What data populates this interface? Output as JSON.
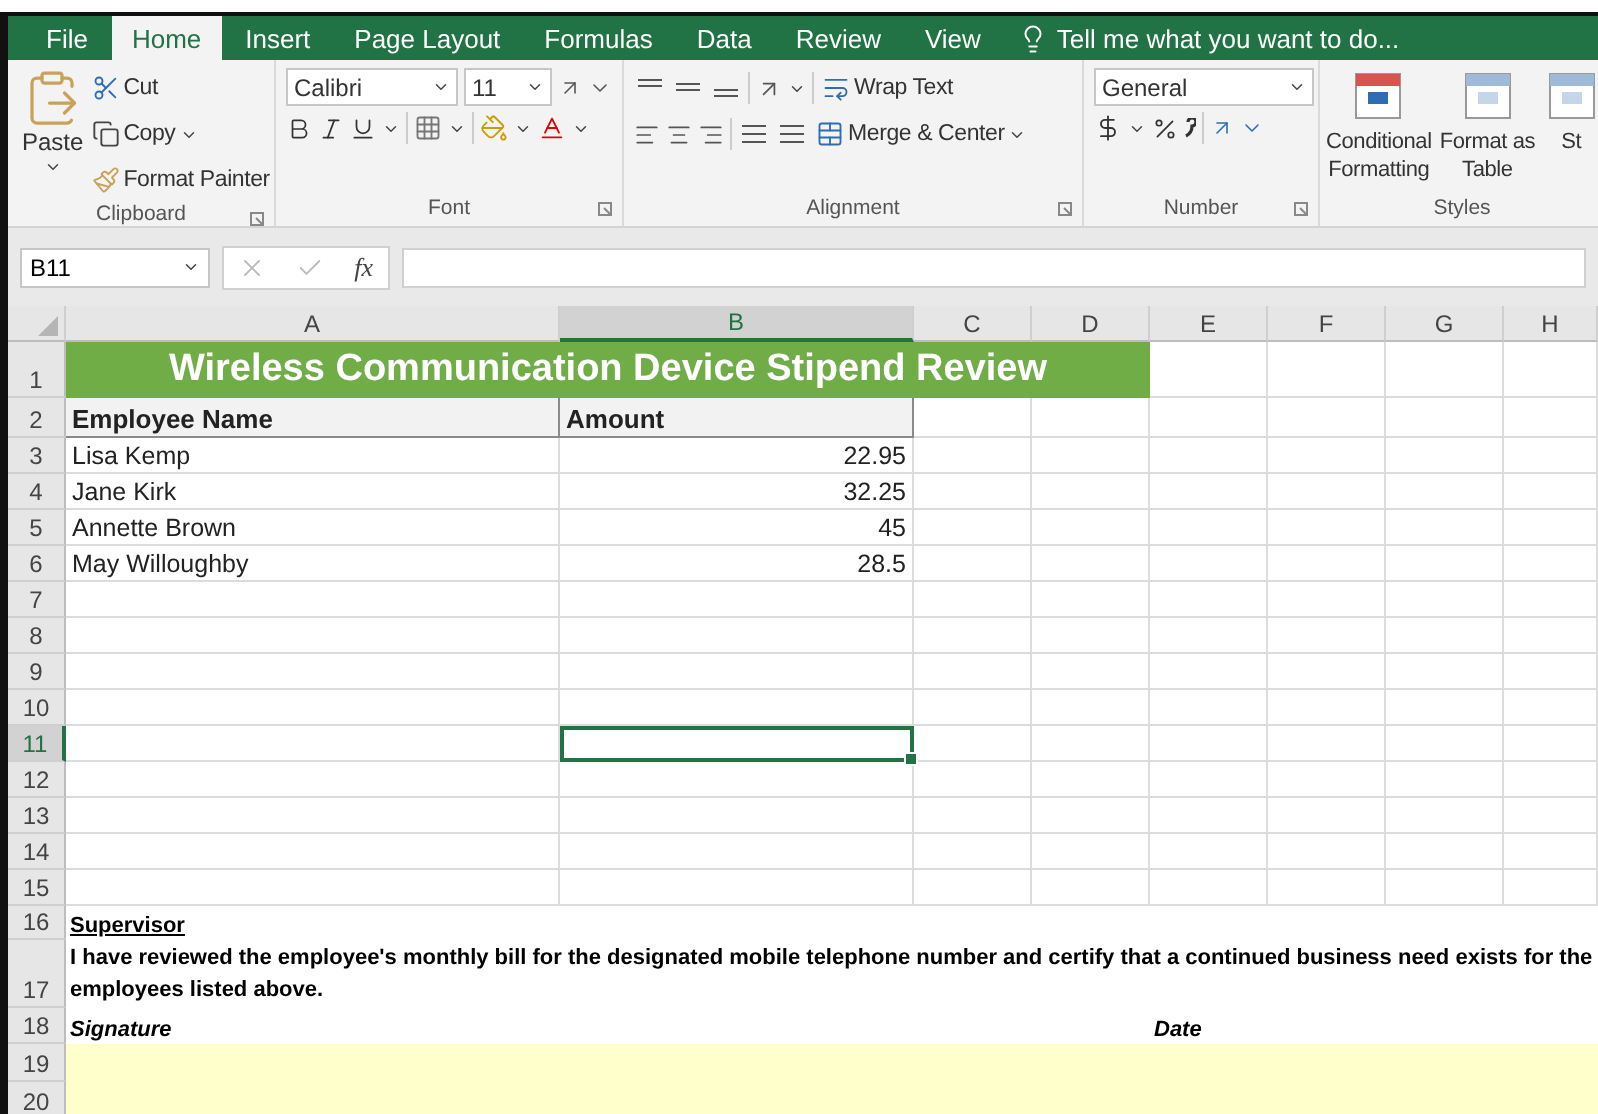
{
  "tabs": [
    {
      "label": "File",
      "selected": false
    },
    {
      "label": "Home",
      "selected": true
    },
    {
      "label": "Insert",
      "selected": false
    },
    {
      "label": "Page Layout",
      "selected": false
    },
    {
      "label": "Formulas",
      "selected": false
    },
    {
      "label": "Data",
      "selected": false
    },
    {
      "label": "Review",
      "selected": false
    },
    {
      "label": "View",
      "selected": false
    }
  ],
  "tell_me": {
    "placeholder": "Tell me what you want to do..."
  },
  "ribbon": {
    "clipboard": {
      "paste": "Paste",
      "cut": "Cut",
      "copy": "Copy",
      "format_painter": "Format Painter",
      "label": "Clipboard"
    },
    "font": {
      "font_name": "Calibri",
      "font_size": "11",
      "label": "Font"
    },
    "alignment": {
      "wrap_text": "Wrap Text",
      "merge_center": "Merge & Center",
      "label": "Alignment"
    },
    "number": {
      "format": "General",
      "label": "Number"
    },
    "styles": {
      "buttons": [
        [
          "Conditional",
          "Formatting"
        ],
        [
          "Format as",
          "Table"
        ],
        [
          "St"
        ]
      ],
      "label": "Styles"
    }
  },
  "formula_bar": {
    "name_box": "B11",
    "fx": "fx"
  },
  "sheet": {
    "columns": [
      {
        "label": "A",
        "selected": false
      },
      {
        "label": "B",
        "selected": true
      },
      {
        "label": "C",
        "selected": false
      },
      {
        "label": "D",
        "selected": false
      },
      {
        "label": "E",
        "selected": false
      },
      {
        "label": "F",
        "selected": false
      },
      {
        "label": "G",
        "selected": false
      },
      {
        "label": "H",
        "selected": false
      }
    ],
    "rows": [
      {
        "number": "1",
        "selected": false,
        "kind": "title",
        "text": "Wireless Communication Device Stipend Review"
      },
      {
        "number": "2",
        "selected": false,
        "kind": "header",
        "cells": [
          "Employee Name",
          "Amount"
        ]
      },
      {
        "number": "3",
        "selected": false,
        "kind": "data",
        "cells": [
          "Lisa Kemp",
          "22.95"
        ]
      },
      {
        "number": "4",
        "selected": false,
        "kind": "data",
        "cells": [
          "Jane Kirk",
          "32.25"
        ]
      },
      {
        "number": "5",
        "selected": false,
        "kind": "data",
        "cells": [
          "Annette Brown",
          "45"
        ]
      },
      {
        "number": "6",
        "selected": false,
        "kind": "data",
        "cells": [
          "May Willoughby",
          "28.5"
        ]
      },
      {
        "number": "7",
        "selected": false,
        "kind": "empty"
      },
      {
        "number": "8",
        "selected": false,
        "kind": "empty"
      },
      {
        "number": "9",
        "selected": false,
        "kind": "empty"
      },
      {
        "number": "10",
        "selected": false,
        "kind": "empty"
      },
      {
        "number": "11",
        "selected": true,
        "kind": "empty"
      },
      {
        "number": "12",
        "selected": false,
        "kind": "empty"
      },
      {
        "number": "13",
        "selected": false,
        "kind": "empty"
      },
      {
        "number": "14",
        "selected": false,
        "kind": "empty"
      },
      {
        "number": "15",
        "selected": false,
        "kind": "empty"
      },
      {
        "number": "16",
        "selected": false,
        "kind": "label",
        "text": "Supervisor"
      },
      {
        "number": "17",
        "selected": false,
        "kind": "note",
        "text": "I have reviewed the employee's monthly bill for the designated mobile telephone number and certify that a continued business need exists for the employees listed above."
      },
      {
        "number": "18",
        "selected": false,
        "kind": "signature",
        "cells": [
          "Signature",
          "Date"
        ]
      },
      {
        "number": "19",
        "selected": false,
        "kind": "fill"
      },
      {
        "number": "20",
        "selected": false,
        "kind": "fill"
      }
    ]
  }
}
